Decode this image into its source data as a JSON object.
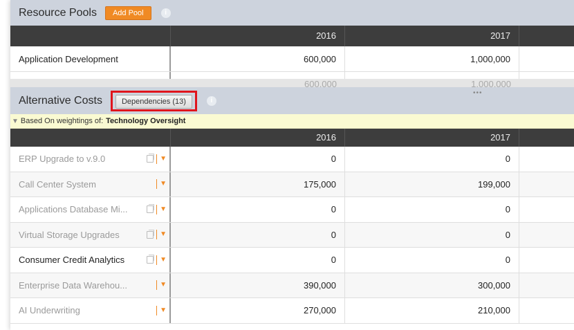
{
  "resource_pools": {
    "title": "Resource Pools",
    "add_label": "Add Pool",
    "info_glyph": "i",
    "columns": [
      "",
      "2016",
      "2017"
    ],
    "rows": [
      {
        "name": "Application Development",
        "v2016": "600,000",
        "v2017": "1,000,000"
      }
    ],
    "totals": {
      "v2016": "600,000",
      "v2017": "1,000,000"
    }
  },
  "alternative_costs": {
    "title": "Alternative Costs",
    "dependencies_label": "Dependencies (13)",
    "info_glyph": "i",
    "filter_prefix": "Based On weightings of:",
    "filter_value": "Technology Oversight",
    "columns": [
      "",
      "2016",
      "2017"
    ],
    "rows": [
      {
        "name": "ERP Upgrade to v.9.0",
        "v2016": "0",
        "v2017": "0"
      },
      {
        "name": "Call Center System",
        "v2016": "175,000",
        "v2017": "199,000"
      },
      {
        "name": "Applications Database Mi...",
        "v2016": "0",
        "v2017": "0"
      },
      {
        "name": "Virtual Storage Upgrades",
        "v2016": "0",
        "v2017": "0"
      },
      {
        "name": "Consumer Credit Analytics",
        "v2016": "0",
        "v2017": "0"
      },
      {
        "name": "Enterprise Data Warehou...",
        "v2016": "390,000",
        "v2017": "300,000"
      },
      {
        "name": "AI Underwriting",
        "v2016": "270,000",
        "v2017": "210,000"
      }
    ]
  },
  "drag_handle_glyph": "•••",
  "colors": {
    "accent": "#f08a24",
    "highlight": "#e0141c",
    "header_dark": "#3d3d3d",
    "section_bg": "#cdd3dd",
    "filter_bg": "#fafad2"
  },
  "icons": [
    "info-icon",
    "filter-icon",
    "copy-icon",
    "chevron-down-icon"
  ]
}
